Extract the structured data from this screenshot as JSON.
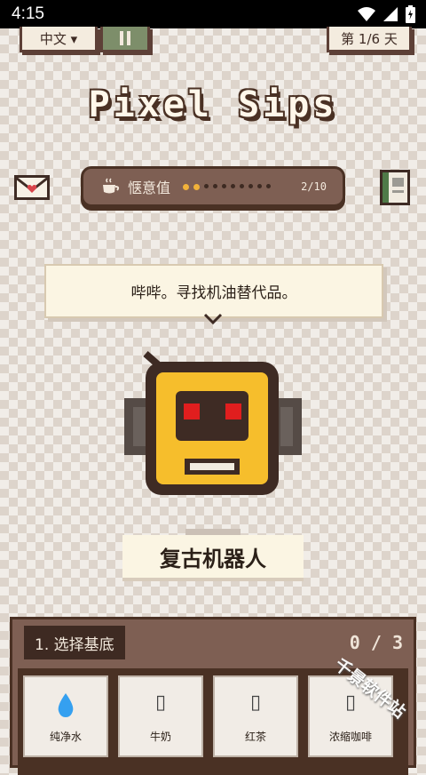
{
  "status_bar": {
    "time": "4:15"
  },
  "top_bar": {
    "language_label": "中文 ▾",
    "pause_icon": "pause-icon",
    "day_label": "第 1/6 天"
  },
  "title": "Pixel Sips",
  "mood": {
    "label": "惬意值",
    "value": 2,
    "max": 10,
    "text": "2/10",
    "icon": "coffee-icon"
  },
  "side_icons": {
    "left": "mail-icon",
    "right": "recipe-book-icon"
  },
  "speech": {
    "text": "哔哔。寻找机油替代品。"
  },
  "character": {
    "name": "复古机器人",
    "icon": "robot-icon"
  },
  "colors": {
    "robot_body": "#f6be2c",
    "robot_eyes": "#e01e1e",
    "mood_dot": "#f1b23a",
    "panel": "#7e5f53"
  },
  "panel": {
    "step_label": "1. 选择基底",
    "progress": "0 / 3",
    "items": [
      {
        "label": "纯净水",
        "icon": "water-drop-icon"
      },
      {
        "label": "牛奶",
        "icon": "▯"
      },
      {
        "label": "红茶",
        "icon": "▯"
      },
      {
        "label": "浓缩咖啡",
        "icon": "▯"
      }
    ]
  },
  "watermark": "千景软件站"
}
